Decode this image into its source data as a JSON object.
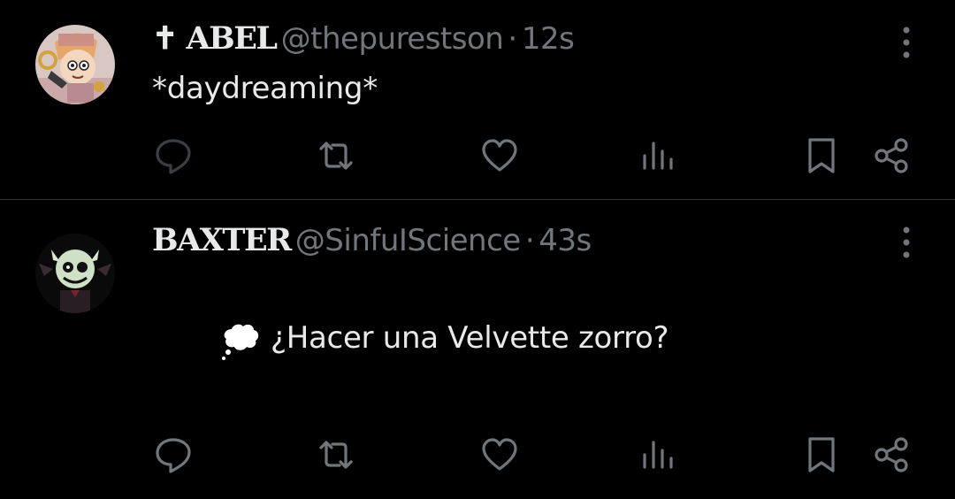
{
  "tweets": [
    {
      "display_name": "✝ ABEL",
      "handle": "@thepurestson",
      "separator": "·",
      "time": "12s",
      "text": "*daydreaming*"
    },
    {
      "display_name": "BAXTER",
      "handle": "@SinfuIScience",
      "separator": "·",
      "time": "43s",
      "emoji_icon": "thought-balloon-icon",
      "text": "¿Hacer una Velvette zorro?"
    }
  ],
  "icons": {
    "reply": "reply-icon",
    "repost": "repost-icon",
    "like": "like-icon",
    "views": "views-icon",
    "bookmark": "bookmark-icon",
    "share": "share-icon",
    "more": "more-icon"
  },
  "colors": {
    "background": "#000000",
    "text": "#e7e9ea",
    "secondary": "#71767b",
    "divider": "#2f3336"
  }
}
